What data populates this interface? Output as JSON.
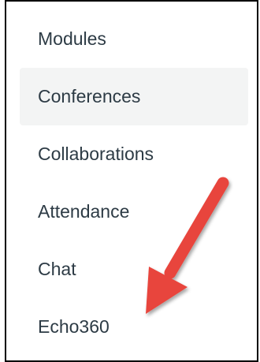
{
  "nav": {
    "items": [
      {
        "label": "Modules"
      },
      {
        "label": "Conferences",
        "active": true
      },
      {
        "label": "Collaborations"
      },
      {
        "label": "Attendance"
      },
      {
        "label": "Chat"
      },
      {
        "label": "Echo360"
      }
    ]
  },
  "annotation": {
    "arrow_color": "#e8453c",
    "target": "Echo360"
  },
  "colors": {
    "text": "#2d3b45",
    "active_background": "#f3f4f4",
    "border": "#000000"
  }
}
